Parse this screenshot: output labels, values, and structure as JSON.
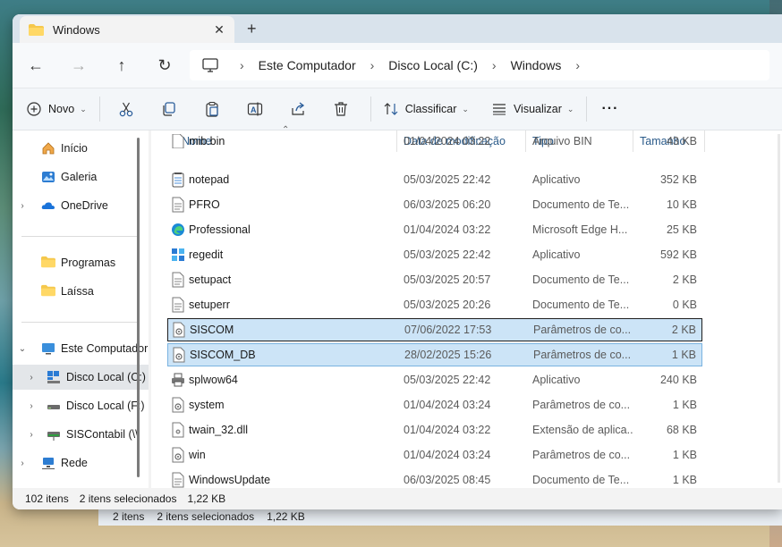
{
  "tab": {
    "title": "Windows",
    "close": "✕",
    "new": "+"
  },
  "nav": {
    "back": "←",
    "forward": "→",
    "up": "↑",
    "refresh": "↻"
  },
  "breadcrumb": [
    "Este Computador",
    "Disco Local (C:)",
    "Windows"
  ],
  "breadcrumb_sep": "›",
  "toolbar": {
    "new_label": "Novo",
    "sort_label": "Classificar",
    "view_label": "Visualizar",
    "more": "···"
  },
  "sidebar": {
    "items": [
      {
        "label": "Início"
      },
      {
        "label": "Galeria"
      },
      {
        "label": "OneDrive"
      },
      {
        "label": "Programas"
      },
      {
        "label": "Laíssa"
      },
      {
        "label": "Este Computador"
      },
      {
        "label": "Disco Local (C:)"
      },
      {
        "label": "Disco Local (F:)"
      },
      {
        "label": "SISContabil (\\\\"
      },
      {
        "label": "Rede"
      }
    ]
  },
  "columns": {
    "name": "Nome",
    "date": "Data de modificação",
    "type": "Tipo",
    "size": "Tamanho"
  },
  "files": [
    {
      "name": "mib.bin",
      "date": "01/04/2024 03:22",
      "type": "Arquivo BIN",
      "size": "43 KB",
      "icon": "file-icon"
    },
    {
      "name": "notepad",
      "date": "05/03/2025 22:42",
      "type": "Aplicativo",
      "size": "352 KB",
      "icon": "notepad-icon"
    },
    {
      "name": "PFRO",
      "date": "06/03/2025 06:20",
      "type": "Documento de Te...",
      "size": "10 KB",
      "icon": "text-file-icon"
    },
    {
      "name": "Professional",
      "date": "01/04/2024 03:22",
      "type": "Microsoft Edge H...",
      "size": "25 KB",
      "icon": "edge-icon"
    },
    {
      "name": "regedit",
      "date": "05/03/2025 22:42",
      "type": "Aplicativo",
      "size": "592 KB",
      "icon": "regedit-icon"
    },
    {
      "name": "setupact",
      "date": "05/03/2025 20:57",
      "type": "Documento de Te...",
      "size": "2 KB",
      "icon": "text-file-icon"
    },
    {
      "name": "setuperr",
      "date": "05/03/2025 20:26",
      "type": "Documento de Te...",
      "size": "0 KB",
      "icon": "text-file-icon"
    },
    {
      "name": "SISCOM",
      "date": "07/06/2022 17:53",
      "type": "Parâmetros de co...",
      "size": "2 KB",
      "icon": "config-file-icon"
    },
    {
      "name": "SISCOM_DB",
      "date": "28/02/2025 15:26",
      "type": "Parâmetros de co...",
      "size": "1 KB",
      "icon": "config-file-icon"
    },
    {
      "name": "splwow64",
      "date": "05/03/2025 22:42",
      "type": "Aplicativo",
      "size": "240 KB",
      "icon": "printer-icon"
    },
    {
      "name": "system",
      "date": "01/04/2024 03:24",
      "type": "Parâmetros de co...",
      "size": "1 KB",
      "icon": "config-file-icon"
    },
    {
      "name": "twain_32.dll",
      "date": "01/04/2024 03:22",
      "type": "Extensão de aplica...",
      "size": "68 KB",
      "icon": "dll-icon"
    },
    {
      "name": "win",
      "date": "01/04/2024 03:24",
      "type": "Parâmetros de co...",
      "size": "1 KB",
      "icon": "config-file-icon"
    },
    {
      "name": "WindowsUpdate",
      "date": "06/03/2025 08:45",
      "type": "Documento de Te...",
      "size": "1 KB",
      "icon": "text-file-icon"
    }
  ],
  "status": {
    "count": "102 itens",
    "selected": "2 itens selecionados",
    "size": "1,22 KB"
  },
  "behind_status": {
    "count": "2 itens",
    "selected": "2 itens selecionados",
    "size": "1,22 KB"
  },
  "colors": {
    "selection": "#cce4f7",
    "accent": "#0067c0",
    "folder": "#f5c84c"
  }
}
